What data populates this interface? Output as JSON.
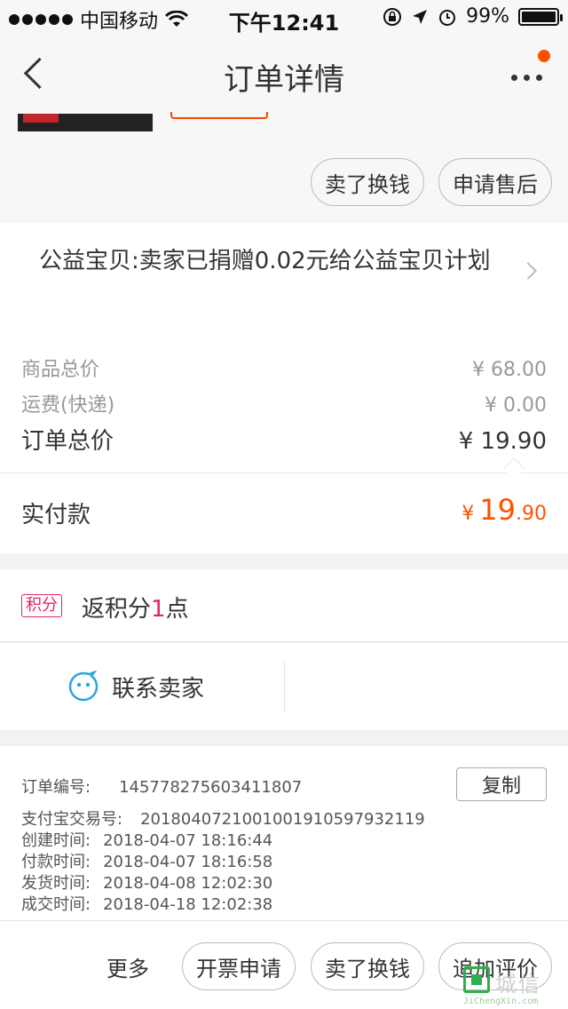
{
  "status_bar": {
    "carrier": "中国移动",
    "time": "下午12:41",
    "battery_percent": "99%",
    "battery_level": 0.99
  },
  "nav": {
    "title": "订单详情"
  },
  "actions_top": {
    "sell_label": "卖了换钱",
    "after_sale_label": "申请售后"
  },
  "charity": {
    "text": "公益宝贝:卖家已捐赠0.02元给公益宝贝计划"
  },
  "price": {
    "goods_total_label": "商品总价",
    "goods_total_value": "¥ 68.00",
    "shipping_label": "运费(快递)",
    "shipping_value": "¥ 0.00",
    "order_total_label": "订单总价",
    "order_total_value": "¥ 19.90",
    "paid_label": "实付款",
    "paid_currency": "¥",
    "paid_int": "19",
    "paid_dec": ".90",
    "accent_color": "#ff5000"
  },
  "points": {
    "badge": "积分",
    "prefix": "返积分",
    "count": "1",
    "suffix": "点"
  },
  "contact": {
    "label": "联系卖家"
  },
  "order_info": {
    "copy_label": "复制",
    "rows": [
      {
        "key": "订单编号:",
        "value": "145778275603411807"
      },
      {
        "key": "支付宝交易号:",
        "value": "2018040721001001910597932119"
      },
      {
        "key": "创建时间:",
        "value": "2018-04-07 18:16:44"
      },
      {
        "key": "付款时间:",
        "value": "2018-04-07 18:16:58"
      },
      {
        "key": "发货时间:",
        "value": "2018-04-08 12:02:30"
      },
      {
        "key": "成交时间:",
        "value": "2018-04-18 12:02:38"
      }
    ]
  },
  "bottom_bar": {
    "more_label": "更多",
    "invoice_label": "开票申请",
    "sell_label": "卖了换钱",
    "review_label": "追加评价"
  },
  "watermark": {
    "chars": "城信",
    "url": "JiChengXin.com"
  }
}
